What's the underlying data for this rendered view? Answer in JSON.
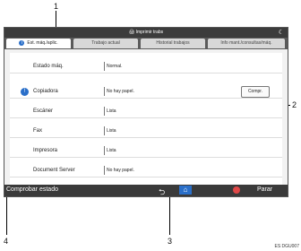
{
  "callouts": [
    "1",
    "2",
    "3",
    "4"
  ],
  "topbar": {
    "title": "🖨 Imprimir trabs",
    "moon": "☾"
  },
  "tabs": [
    "Est. máq./aplic.",
    "Trabajo actual",
    "Historial trabajos",
    "Info mant./consultas/máq."
  ],
  "estado": {
    "name": "Estado máq.",
    "status": "Normal."
  },
  "rows": [
    {
      "name": "Copiadora",
      "status": "No hay papel."
    },
    {
      "name": "Escáner",
      "status": "Lista"
    },
    {
      "name": "Fax",
      "status": "Lista"
    },
    {
      "name": "Impresora",
      "status": "Lista"
    },
    {
      "name": "Document Server",
      "status": "No hay papel."
    }
  ],
  "compr_label": "Compr.",
  "alert_icon": "!",
  "bottom": {
    "check_label": "Comprobar estado",
    "back_icon": "⮌",
    "home_icon": "⌂",
    "stop_label": "Parar"
  },
  "code": "ES DGU007"
}
